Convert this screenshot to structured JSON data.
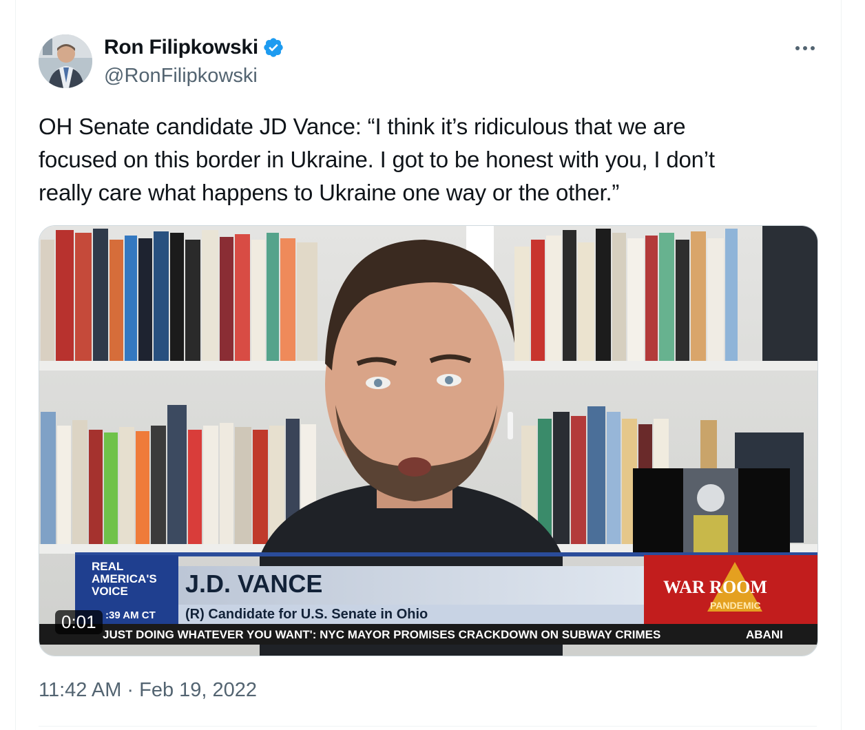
{
  "author": {
    "name": "Ron Filipkowski",
    "handle": "@RonFilipkowski",
    "verified_badge_color": "#1d9bf0"
  },
  "tweet": {
    "text_lines": [
      "OH Senate candidate JD Vance: “I think it’s ridiculous that we are",
      "focused on this border in Ukraine. I got to be honest with you, I don’t",
      "really care what happens to Ukraine one way or the other.”"
    ],
    "timestamp": "11:42 AM · Feb 19, 2022"
  },
  "video": {
    "duration": "0:01",
    "network_logo": "REAL AMERICA'S VOICE",
    "lower_third_name": "J.D. VANCE",
    "lower_third_title": "(R) Candidate for U.S. Senate in Ohio",
    "clock": ":39 AM CT",
    "ticker": "JUST DOING WHATEVER YOU WANT': NYC MAYOR PROMISES CRACKDOWN ON SUBWAY CRIMES",
    "ticker_right": "ABANI",
    "show_logo_line1": "WAR ROOM",
    "show_logo_line2": "PANDEMIC"
  },
  "icons": {
    "more": "more-icon",
    "verified": "verified-badge-icon"
  },
  "colors": {
    "text_primary": "#0f1419",
    "text_secondary": "#536471",
    "accent": "#1d9bf0"
  }
}
